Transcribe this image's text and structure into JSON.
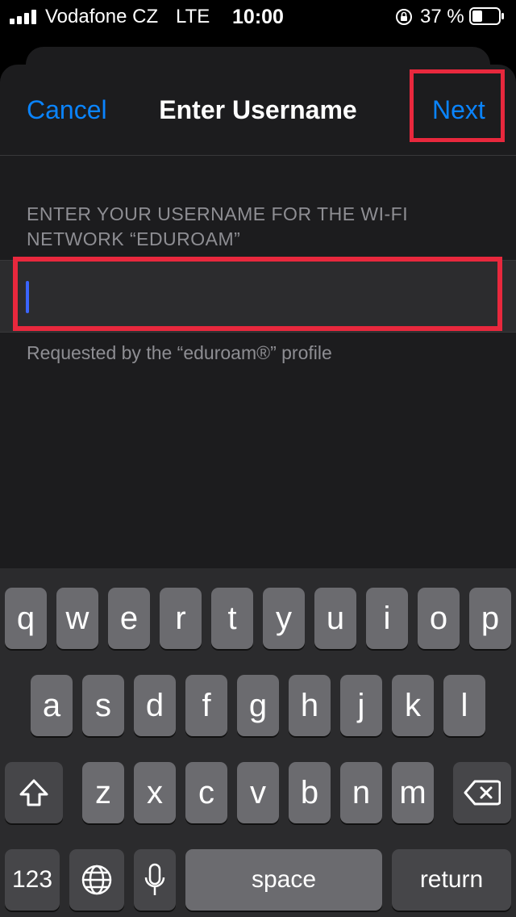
{
  "status_bar": {
    "carrier": "Vodafone CZ",
    "network": "LTE",
    "time": "10:00",
    "battery": "37 %"
  },
  "nav": {
    "cancel_label": "Cancel",
    "title": "Enter Username",
    "next_label": "Next"
  },
  "form": {
    "section_header": "ENTER YOUR USERNAME FOR THE WI-FI NETWORK “EDUROAM”",
    "username_value": "",
    "footer_note": "Requested by the “eduroam®” profile"
  },
  "keyboard": {
    "row1": [
      "q",
      "w",
      "e",
      "r",
      "t",
      "y",
      "u",
      "i",
      "o",
      "p"
    ],
    "row2": [
      "a",
      "s",
      "d",
      "f",
      "g",
      "h",
      "j",
      "k",
      "l"
    ],
    "row3": [
      "z",
      "x",
      "c",
      "v",
      "b",
      "n",
      "m"
    ],
    "numbers_label": "123",
    "space_label": "space",
    "return_label": "return",
    "icons": [
      "shift-icon",
      "backspace-icon",
      "globe-icon",
      "microphone-icon"
    ]
  },
  "colors": {
    "accent": "#0a84ff",
    "highlight": "#e8283d",
    "background": "#1c1c1e"
  }
}
